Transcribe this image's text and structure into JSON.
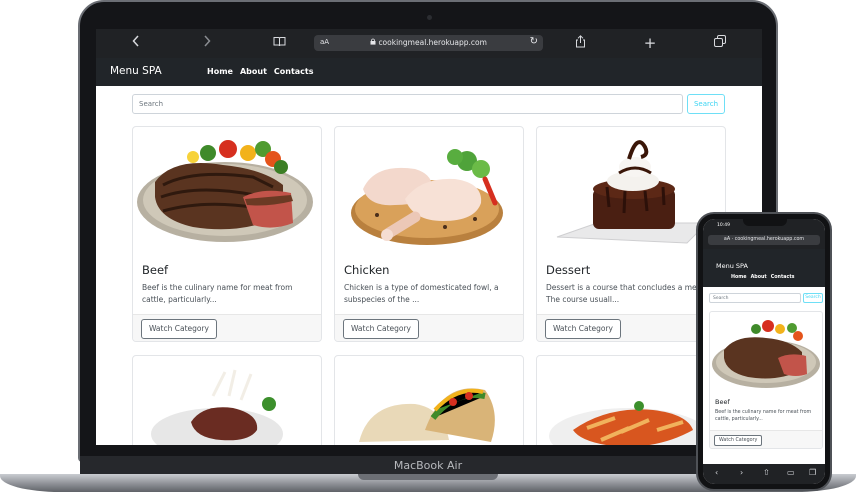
{
  "laptop": {
    "brand_label": "MacBook Air"
  },
  "browser": {
    "url": "cookingmeal.herokuapp.com",
    "aa_label": "aA",
    "icons": [
      "back-icon",
      "forward-icon",
      "book-icon",
      "share-icon",
      "new-tab-icon",
      "tabs-icon",
      "reload-icon",
      "lock-icon"
    ]
  },
  "navbar": {
    "brand": "Menu SPA",
    "links": [
      "Home",
      "About",
      "Contacts"
    ]
  },
  "search": {
    "placeholder": "Search",
    "button_label": "Search"
  },
  "cards": [
    {
      "title": "Beef",
      "text": "Beef is the culinary name for meat from cattle, particularly...",
      "button": "Watch Category",
      "image": "beef-steak-image"
    },
    {
      "title": "Chicken",
      "text": "Chicken is a type of domesticated fowl, a subspecies of the ...",
      "button": "Watch Category",
      "image": "chicken-legs-image"
    },
    {
      "title": "Dessert",
      "text": "Dessert is a course that concludes a meal. The course usuall...",
      "button": "Watch Category",
      "image": "chocolate-dessert-image"
    },
    {
      "image": "lamb-chops-image"
    },
    {
      "image": "tacos-image"
    },
    {
      "image": "pasta-image"
    }
  ],
  "phone": {
    "time": "10:49",
    "url": "cookingmeal.herokuapp.com",
    "aa_label": "aA",
    "brand": "Menu SPA",
    "links": [
      "Home",
      "About",
      "Contacts"
    ],
    "search_placeholder": "Search",
    "search_button": "Search",
    "card": {
      "title": "Beef",
      "text": "Beef is the culinary name for meat from cattle, particularly...",
      "button": "Watch Category"
    }
  },
  "colors": {
    "navbar_bg": "#212529",
    "search_accent": "#3dd5f3",
    "device_frame": "#141518"
  }
}
